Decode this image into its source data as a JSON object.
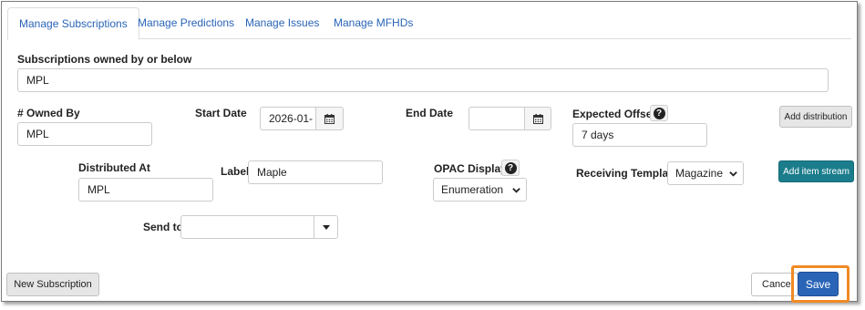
{
  "tabs": [
    {
      "label": "Manage Subscriptions",
      "active": true
    },
    {
      "label": "Manage Predictions",
      "active": false
    },
    {
      "label": "Manage Issues",
      "active": false
    },
    {
      "label": "Manage MFHDs",
      "active": false
    }
  ],
  "subscriptions_owned": {
    "label": "Subscriptions owned by or below",
    "value": "MPL"
  },
  "owned_by": {
    "label": "# Owned By",
    "value": "MPL"
  },
  "start_date": {
    "label": "Start Date",
    "value": "2026-01-"
  },
  "end_date": {
    "label": "End Date",
    "value": ""
  },
  "expected_offset": {
    "label": "Expected Offset",
    "value": "7 days"
  },
  "add_distribution_label": "Add distribution",
  "distributed_at": {
    "label": "Distributed At",
    "value": "MPL"
  },
  "label_field": {
    "label": "Label",
    "value": "Maple"
  },
  "opac_display": {
    "label": "OPAC Display",
    "value": "Enumeration"
  },
  "receiving_template": {
    "label": "Receiving Template",
    "value": "Magazine"
  },
  "add_item_stream_label": "Add item stream",
  "send_to": {
    "label": "Send to",
    "value": ""
  },
  "new_subscription_label": "New Subscription",
  "cancel_label": "Cancel",
  "save_label": "Save",
  "icons": {
    "help": "help-icon",
    "calendar": "calendar-icon",
    "chevron": "chevron-down-icon",
    "caret": "caret-down-icon"
  },
  "colors": {
    "link": "#2a64b7",
    "teal": "#1b7d8c",
    "primary": "#2a64b7",
    "highlight": "#f08a24"
  }
}
